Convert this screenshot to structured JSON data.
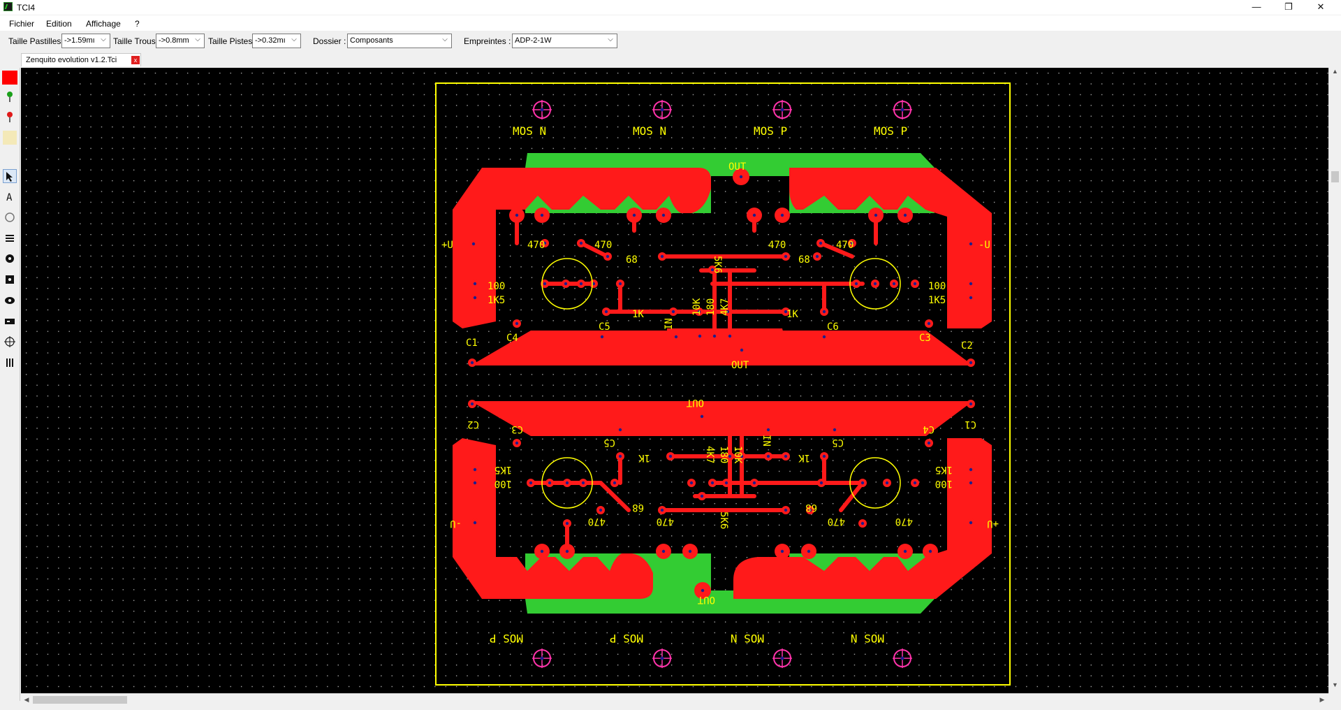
{
  "window": {
    "title": "TCI4",
    "min_symbol": "—",
    "max_symbol": "❐",
    "close_symbol": "✕"
  },
  "menu": [
    "Fichier",
    "Edition",
    "Affichage",
    "?"
  ],
  "toolbar": {
    "pad_label": "Taille Pastilles",
    "pad_value": "->1.59mı",
    "hole_label": "Taille Trous",
    "hole_value": "->0.8mm",
    "track_label": "Taille Pistes",
    "track_value": "->0.32mı",
    "folder_label": "Dossier :",
    "folder_value": "Composants",
    "footprint_label": "Empreintes :",
    "footprint_value": "ADP-2-1W"
  },
  "document_tab": {
    "label": "Zenquito evolution v1.2.Tci",
    "close": "x"
  },
  "tools": [
    "color-swatch",
    "pin-green",
    "pin-red",
    "blank",
    "select-arrow",
    "text-tool",
    "circle-tool",
    "line-tool",
    "pad-round",
    "pad-square",
    "pad-oval",
    "smd-tool",
    "crosshair-tool",
    "dots-tool"
  ],
  "colors": {
    "copper": "#ff1a1a",
    "ground_fill": "#33cc33",
    "silkscreen": "#ffff00",
    "pad_hole": "#1e1e8c",
    "via": "#ff33aa",
    "background": "#000000"
  },
  "pcb": {
    "top": {
      "mos_labels": [
        "MOS N",
        "MOS N",
        "MOS P",
        "MOS P"
      ],
      "labels": [
        "OUT",
        "+U",
        "-U",
        "470",
        "470",
        "470",
        "470",
        "68",
        "68",
        "5K6",
        "100",
        "1K5",
        "100",
        "1K5",
        "1K",
        "1K",
        "10K",
        "180",
        "4K7",
        "IN",
        "C5",
        "C6",
        "C1",
        "C4",
        "C3",
        "C2",
        "OUT"
      ]
    },
    "bottom": {
      "mos_labels": [
        "MOS P",
        "MOS P",
        "MOS N",
        "MOS N"
      ],
      "labels": [
        "OUT",
        "C2",
        "C3",
        "C5",
        "1K",
        "4K7",
        "180",
        "10K",
        "IN",
        "1K",
        "C5",
        "C4",
        "C1",
        "1K5",
        "100",
        "1K5",
        "100",
        "-U",
        "+U",
        "470",
        "68",
        "470",
        "5K6",
        "68",
        "470",
        "470",
        "OUT"
      ]
    }
  }
}
